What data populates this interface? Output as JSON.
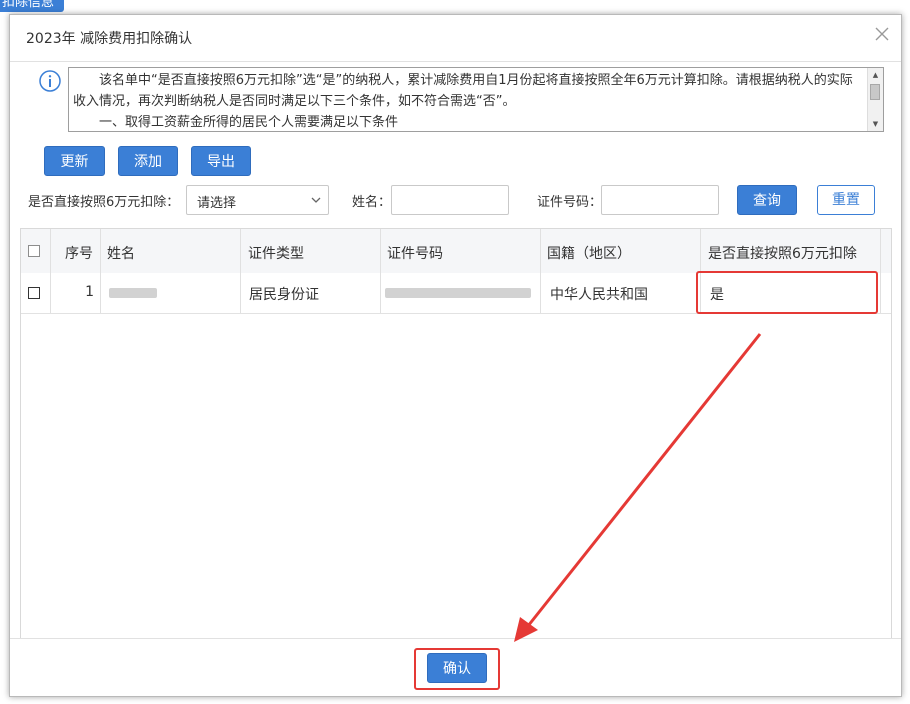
{
  "background": {
    "tab_label": "扣除信息"
  },
  "dialog": {
    "title": "2023年 减除费用扣除确认",
    "close_icon": "close-icon",
    "notice": {
      "icon": "info-icon",
      "line1": "该名单中“是否直接按照6万元扣除”选“是”的纳税人，累计减除费用自1月份起将直接按照全年6万元计算扣除。请根据纳税人的实际收入情况，再次判断纳税人是否同时满足以下三个条件，如不符合需选“否”。",
      "line2": "一、取得工资薪金所得的居民个人需要满足以下条件"
    },
    "toolbar": {
      "update": "更新",
      "add": "添加",
      "export": "导出"
    },
    "filters": {
      "deduct_label": "是否直接按照6万元扣除：",
      "deduct_value": "请选择",
      "name_label": "姓名：",
      "name_value": "",
      "id_label": "证件号码：",
      "id_value": "",
      "query": "查询",
      "reset": "重置"
    },
    "table": {
      "columns": [
        "序号",
        "姓名",
        "证件类型",
        "证件号码",
        "国籍（地区）",
        "是否直接按照6万元扣除"
      ],
      "rows": [
        {
          "seq": "1",
          "name": "",
          "id_type": "居民身份证",
          "id_no": "",
          "nationality": "中华人民共和国",
          "deduct": "是"
        }
      ]
    },
    "footer": {
      "confirm": "确认"
    }
  },
  "colors": {
    "primary": "#3b7fd6",
    "highlight": "#e53935"
  }
}
